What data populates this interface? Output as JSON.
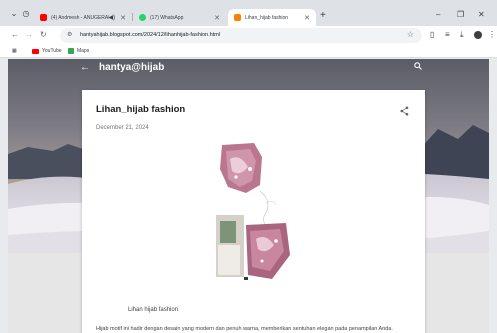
{
  "browser": {
    "tabs": [
      {
        "title": "(4) Andmesh - ANUGERAH",
        "favicon_color": "#ff0000",
        "active": false
      },
      {
        "title": "(17) WhatsApp",
        "favicon_color": "#25d366",
        "active": false
      },
      {
        "title": "Lihan_hijab fashion",
        "favicon_color": "#ff7f00",
        "active": true
      }
    ],
    "address": "hantyahijab.blogspot.com/2024/12/lihanhijab-fashion.html",
    "bookmarks": [
      {
        "label": "YouTube",
        "color": "#ff0000"
      },
      {
        "label": "Maps",
        "color": "#34a853"
      }
    ]
  },
  "blog": {
    "name": "hantya@hijab",
    "post": {
      "title": "Lihan_hijab fashion",
      "date": "December 21, 2024",
      "caption": "Lihan hijab fashion",
      "excerpt": "Hijab motif ini hadir dengan desain yang modern dan penuh warna, memberikan sentuhan elegan pada penampilan Anda."
    }
  },
  "colors": {
    "accent_pink": "#c77b98",
    "sky": "#7d7b84",
    "sand": "#e7e4e9"
  },
  "icons": [
    "search-icon",
    "back-arrow-icon",
    "share-icon",
    "star-icon",
    "download-icon",
    "extensions-icon"
  ]
}
